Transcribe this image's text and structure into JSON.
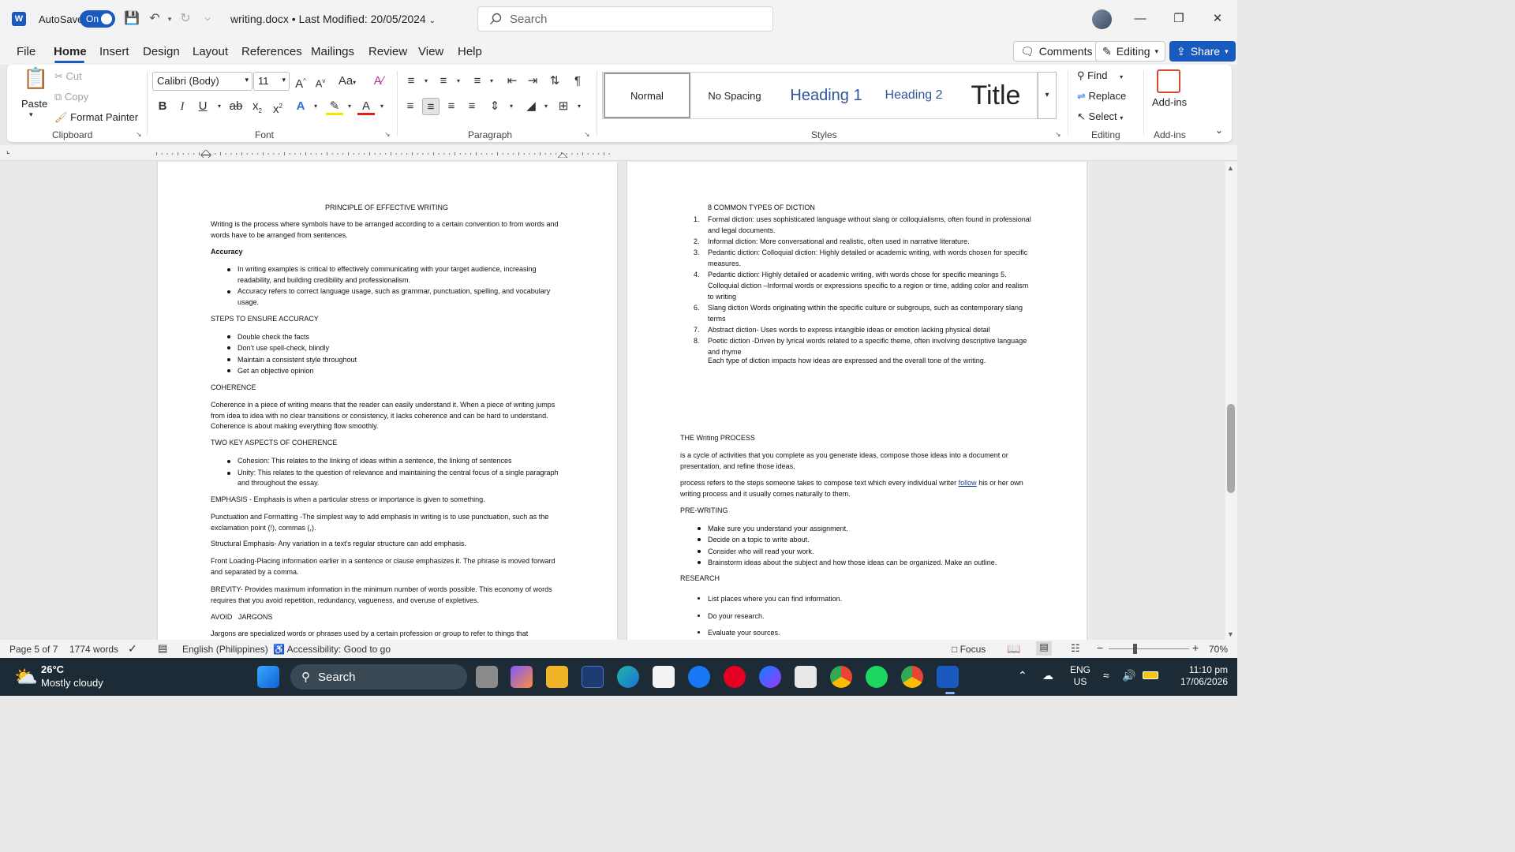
{
  "titlebar": {
    "autosave_label": "AutoSave",
    "autosave_state": "On",
    "doc_title": "writing.docx • Last Modified: 20/05/2024",
    "search_placeholder": "Search"
  },
  "tabs": [
    "File",
    "Home",
    "Insert",
    "Design",
    "Layout",
    "References",
    "Mailings",
    "Review",
    "View",
    "Help"
  ],
  "header_buttons": {
    "comments": "Comments",
    "editing": "Editing",
    "share": "Share"
  },
  "ribbon": {
    "clipboard": {
      "paste": "Paste",
      "cut": "Cut",
      "copy": "Copy",
      "format_painter": "Format Painter",
      "label": "Clipboard"
    },
    "font": {
      "family": "Calibri (Body)",
      "size": "11",
      "label": "Font"
    },
    "paragraph": {
      "label": "Paragraph"
    },
    "styles": {
      "items": [
        "Normal",
        "No Spacing",
        "Heading 1",
        "Heading 2",
        "Title"
      ],
      "label": "Styles"
    },
    "editing": {
      "find": "Find",
      "replace": "Replace",
      "select": "Select",
      "label": "Editing"
    },
    "addins": {
      "button": "Add-ins",
      "label": "Add-ins"
    }
  },
  "page_left": {
    "title": "PRINCIPLE OF EFFECTIVE WRITING",
    "intro": "Writing is the process where symbols have to be arranged according to a certain convention to from words and words have to be arranged from sentences.",
    "accuracy_heading": "Accuracy",
    "accuracy_bullets": [
      "In writing examples is critical to effectively communicating with your target audience, increasing readability, and building credibility and professionalism.",
      "Accuracy refers to correct language usage, such as grammar, punctuation, spelling, and vocabulary usage."
    ],
    "steps_heading": "STEPS TO ENSURE ACCURACY",
    "steps_bullets": [
      "Double check the facts",
      "Don’t use spell-check, blindly",
      "Maintain a consistent style throughout",
      "Get an objective opinion"
    ],
    "coherence_heading": "COHERENCE",
    "coherence_text": "Coherence in a piece of writing means that the reader can easily understand it. When a piece of writing jumps from idea to idea with no clear transitions or consistency, it lacks coherence and can be hard to understand. Coherence is about making everything flow smoothly.",
    "two_aspects_heading": "TWO KEY ASPECTS OF COHERENCE",
    "two_aspects_bullets": [
      "Cohesion: This relates to the linking of ideas within a sentence, the linking of sentences",
      "Unity: This relates to the question of relevance and maintaining the central focus of a single paragraph and throughout the essay."
    ],
    "emphasis": "EMPHASIS - Emphasis is when a particular stress or importance is given to something.",
    "punctuation": "Punctuation and Formatting -The simplest way to add emphasis in writing is to use punctuation, such as the exclamation point (!), commas (,).",
    "structural": "Structural Emphasis- Any variation in a text’s regular structure can add emphasis.",
    "front_loading": "Front Loading-Placing information earlier in a sentence or clause emphasizes it. The phrase is moved forward and separated by a comma.",
    "brevity": "BREVITY- Provides maximum information in the minimum number of words possible. This economy of words requires that you avoid repetition, redundancy, vagueness, and overuse of expletives.",
    "avoid_jargons": "AVOID   JARGONS",
    "jargons_text": "Jargons are specialized words or phrases used by a certain profession or group to refer to things that"
  },
  "page_right": {
    "diction_heading": "8 COMMON TYPES OF DICTION",
    "diction_items": [
      {
        "n": "1.",
        "text": "Formal diction: uses sophisticated language without slang or colloquialisms, often found in professional and legal documents."
      },
      {
        "n": "2.",
        "text": "Informal diction: More conversational and realistic, often used in narrative literature."
      },
      {
        "n": "3.",
        "text": "Pedantic diction: Colloquial diction: Highly detailed or academic writing, with words chosen for specific measures."
      },
      {
        "n": "4.",
        "text": " Pedantic diction: Highly detailed or academic writing, with words chose for specific meanings 5. Colloquial diction –Informal words or expressions specific to a region or time, adding color and realism to writing"
      },
      {
        "n": "6.",
        "text": "Slang diction Words originating within the specific culture or subgroups, such as contemporary slang terms"
      },
      {
        "n": "7.",
        "text": "Abstract diction- Uses words to express intangible ideas or emotion lacking physical detail"
      },
      {
        "n": "8.",
        "text": "Poetic diction -Driven by lyrical words related to a specific theme, often involving descriptive language and rhyme"
      }
    ],
    "diction_summary": "Each type of diction impacts how ideas are expressed and the overall tone of the writing.",
    "process_heading": "THE Writing PROCESS",
    "process_text1": "is a cycle of activities that you complete as you generate ideas, compose those ideas into a document or presentation, and refine those ideas.",
    "process_text2a": "process refers to the steps someone takes to compose text which every individual writer ",
    "process_text2_link": "follow",
    "process_text2b": " his or her own writing process and it usually comes naturally to them.",
    "prewriting_heading": "PRE-WRITING",
    "prewriting_bullets": [
      "Make sure you understand your assignment.",
      "Decide on a topic to write about.",
      "Consider who will read your work.",
      "Brainstorm ideas about the subject and how those ideas can be organized. Make an outline."
    ],
    "research_heading": "RESEARCH",
    "research_bullets": [
      "List places where you can find information.",
      "Do your research.",
      "Evaluate your sources."
    ]
  },
  "status": {
    "page": "Page 5 of 7",
    "words": "1774 words",
    "language": "English (Philippines)",
    "accessibility": "Accessibility: Good to go",
    "focus": "Focus",
    "zoom": "70%"
  },
  "taskbar": {
    "weather_temp": "26°C",
    "weather_desc": "Mostly cloudy",
    "search": "Search",
    "lang1": "ENG",
    "lang2": "US",
    "time": "11:10 pm",
    "date": "17/06/2026"
  },
  "colors": {
    "accent": "#185abd",
    "heading_blue": "#2f5597"
  }
}
